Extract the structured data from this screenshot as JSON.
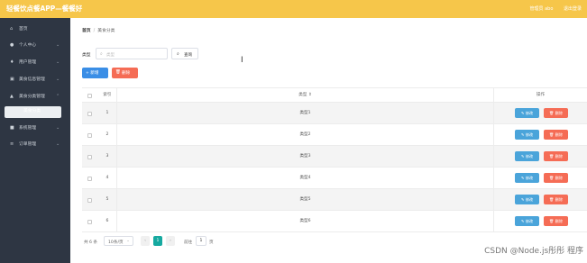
{
  "app": {
    "title": "轻餐饮点餐APP—餐餐好",
    "top_right": [
      "管理员 abo",
      "退出登录"
    ]
  },
  "sidebar": {
    "items": [
      {
        "label": "首页",
        "icon": "home-icon",
        "icon_glyph": "⌂",
        "has_chevron": false
      },
      {
        "label": "个人中心",
        "icon": "user-icon",
        "icon_glyph": "👤",
        "has_chevron": true
      },
      {
        "label": "用户管理",
        "icon": "user-manage-icon",
        "icon_glyph": "♦",
        "has_chevron": true
      },
      {
        "label": "美食信息管理",
        "icon": "food-info-icon",
        "icon_glyph": "▣",
        "has_chevron": true
      },
      {
        "label": "美食分类管理",
        "icon": "category-icon",
        "icon_glyph": "▲",
        "has_chevron": true
      },
      {
        "label": "美食分类",
        "icon": "",
        "icon_glyph": "",
        "has_chevron": false,
        "active": true
      },
      {
        "label": "系统管理",
        "icon": "system-icon",
        "icon_glyph": "■",
        "has_chevron": true
      },
      {
        "label": "订单管理",
        "icon": "order-icon",
        "icon_glyph": "≡",
        "has_chevron": true
      }
    ]
  },
  "breadcrumb": {
    "home": "首页",
    "sep": "/",
    "current": "美食分类"
  },
  "filter": {
    "label": "类型",
    "placeholder": "类型",
    "query_label": "查询"
  },
  "actions": {
    "add_label": "+ 新增",
    "delete_label": "删除"
  },
  "table": {
    "headers": {
      "index": "索引",
      "type": "类型 ⇕",
      "ops": "操作"
    },
    "rows": [
      {
        "index": "1",
        "type": "类型1"
      },
      {
        "index": "2",
        "type": "类型2"
      },
      {
        "index": "3",
        "type": "类型3"
      },
      {
        "index": "4",
        "type": "类型4"
      },
      {
        "index": "5",
        "type": "类型5"
      },
      {
        "index": "6",
        "type": "类型6"
      }
    ],
    "edit_label": "修改",
    "delete_label": "删除"
  },
  "pagination": {
    "total": "共 6 条",
    "page_size": "10条/页",
    "prev": "‹",
    "current_page": "1",
    "next": "›",
    "goto_label": "前往",
    "goto_value": "1",
    "unit": "页"
  },
  "watermark": "CSDN @Node.js彤彤 程序",
  "colors": {
    "topbar": "#f6c64a",
    "sidebar": "#2e3643",
    "primary": "#3a8ee6",
    "danger": "#f56c55",
    "edit": "#4aa4da",
    "page_active": "#16a9a0"
  }
}
